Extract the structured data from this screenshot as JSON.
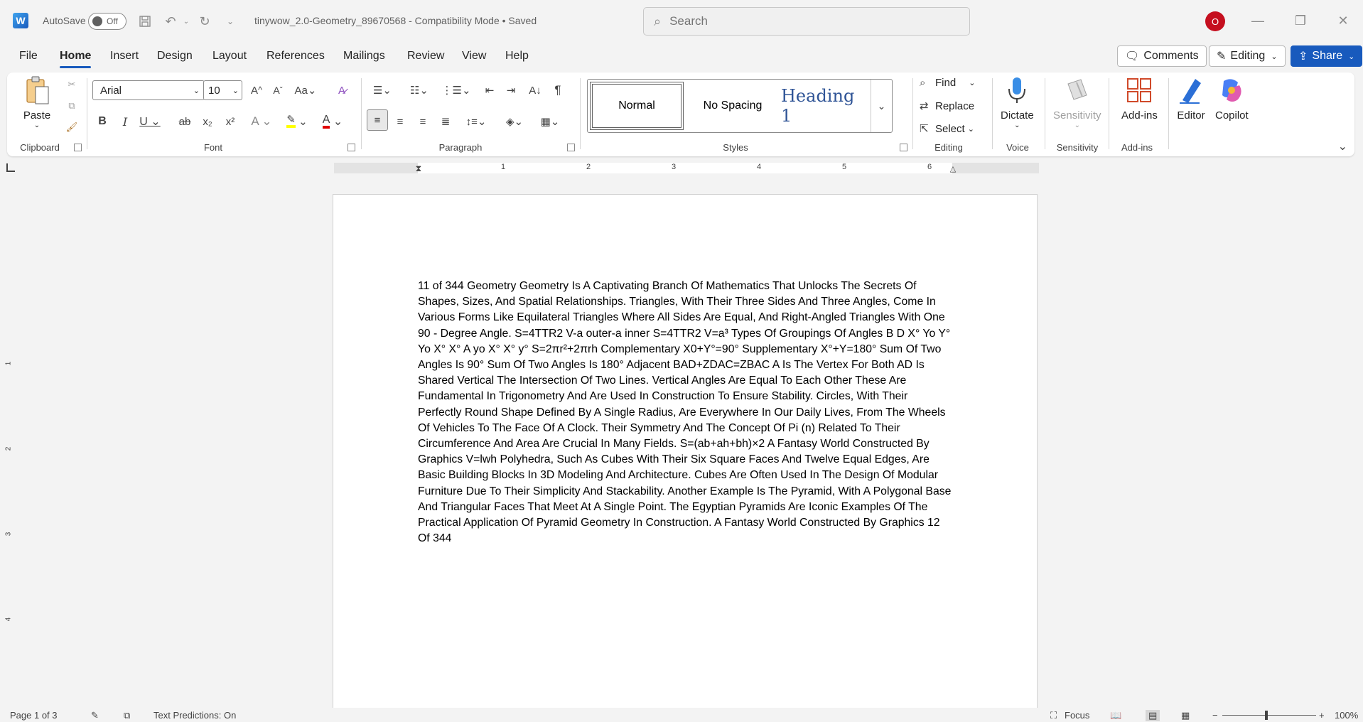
{
  "titlebar": {
    "autosave_label": "AutoSave",
    "autosave_state": "Off",
    "doc_title": "tinywow_2.0-Geometry_89670568  -  Compatibility Mode  •  Saved",
    "search_placeholder": "Search",
    "avatar_initial": "O"
  },
  "menu": {
    "tabs": [
      "File",
      "Home",
      "Insert",
      "Design",
      "Layout",
      "References",
      "Mailings",
      "Review",
      "View",
      "Help"
    ],
    "active_tab": "Home",
    "comments_label": "Comments",
    "editing_label": "Editing",
    "share_label": "Share"
  },
  "ribbon": {
    "clipboard": {
      "paste_label": "Paste",
      "group_label": "Clipboard"
    },
    "font": {
      "font_name": "Arial",
      "font_size": "10",
      "group_label": "Font"
    },
    "paragraph": {
      "group_label": "Paragraph"
    },
    "styles": {
      "items": [
        "Normal",
        "No Spacing",
        "Heading 1"
      ],
      "selected": "Normal",
      "group_label": "Styles"
    },
    "editing": {
      "find_label": "Find",
      "replace_label": "Replace",
      "select_label": "Select",
      "group_label": "Editing"
    },
    "voice": {
      "dictate_label": "Dictate",
      "group_label": "Voice"
    },
    "sensitivity": {
      "button_label": "Sensitivity",
      "group_label": "Sensitivity"
    },
    "addins": {
      "button_label": "Add-ins",
      "group_label": "Add-ins"
    },
    "editor_label": "Editor",
    "copilot_label": "Copilot",
    "colors": {
      "accent": "#185abd",
      "highlight": "#ffff00",
      "font_color": "#e00000"
    }
  },
  "ruler": {
    "numbers": [
      "1",
      "2",
      "3",
      "4",
      "5",
      "6"
    ],
    "vertical_numbers": [
      "1",
      "2",
      "3",
      "4"
    ]
  },
  "document": {
    "body": "11 of 344 Geometry Geometry Is A Captivating Branch Of Mathematics That Unlocks The Secrets Of Shapes, Sizes, And Spatial Relationships. Triangles, With Their Three Sides And Three Angles, Come In Various Forms Like Equilateral Triangles Where All Sides Are Equal, And Right-Angled Triangles With One 90 - Degree Angle. S=4TTR2 V-a outer-a inner S=4TTR2 V=a³ Types Of Groupings Of Angles B D X° Yo Y° Yo X° X° A yo X° X° y° S=2πr²+2πrh Complementary X0+Y°=90° Supplementary X°+Y=180° Sum Of Two Angles Is 90° Sum Of Two Angles Is 180° Adjacent BAD+ZDAC=ZBAC A Is The Vertex For Both AD Is Shared Vertical The Intersection Of Two Lines. Vertical Angles Are Equal To Each Other These Are Fundamental In Trigonometry And Are Used In Construction To Ensure Stability. Circles, With Their Perfectly Round Shape Defined By A Single Radius, Are Everywhere In Our Daily Lives, From The Wheels Of Vehicles To The Face Of A Clock. Their Symmetry And The Concept Of Pi (n) Related To Their Circumference And Area Are Crucial In Many Fields. S=(ab+ah+bh)×2 A Fantasy World Constructed By Graphics V=lwh Polyhedra, Such As Cubes With Their Six Square Faces And Twelve Equal Edges, Are Basic Building Blocks In 3D Modeling And Architecture. Cubes Are Often Used In The Design Of Modular Furniture Due To Their Simplicity And Stackability. Another Example Is The Pyramid, With A Polygonal Base And Triangular Faces That Meet At A Single Point. The Egyptian Pyramids Are Iconic Examples Of The Practical Application Of Pyramid Geometry In Construction. A Fantasy World Constructed By Graphics 12 Of 344"
  },
  "status": {
    "page_info": "Page 1 of 3",
    "text_predictions": "Text Predictions: On",
    "focus_label": "Focus",
    "zoom": "100%"
  }
}
